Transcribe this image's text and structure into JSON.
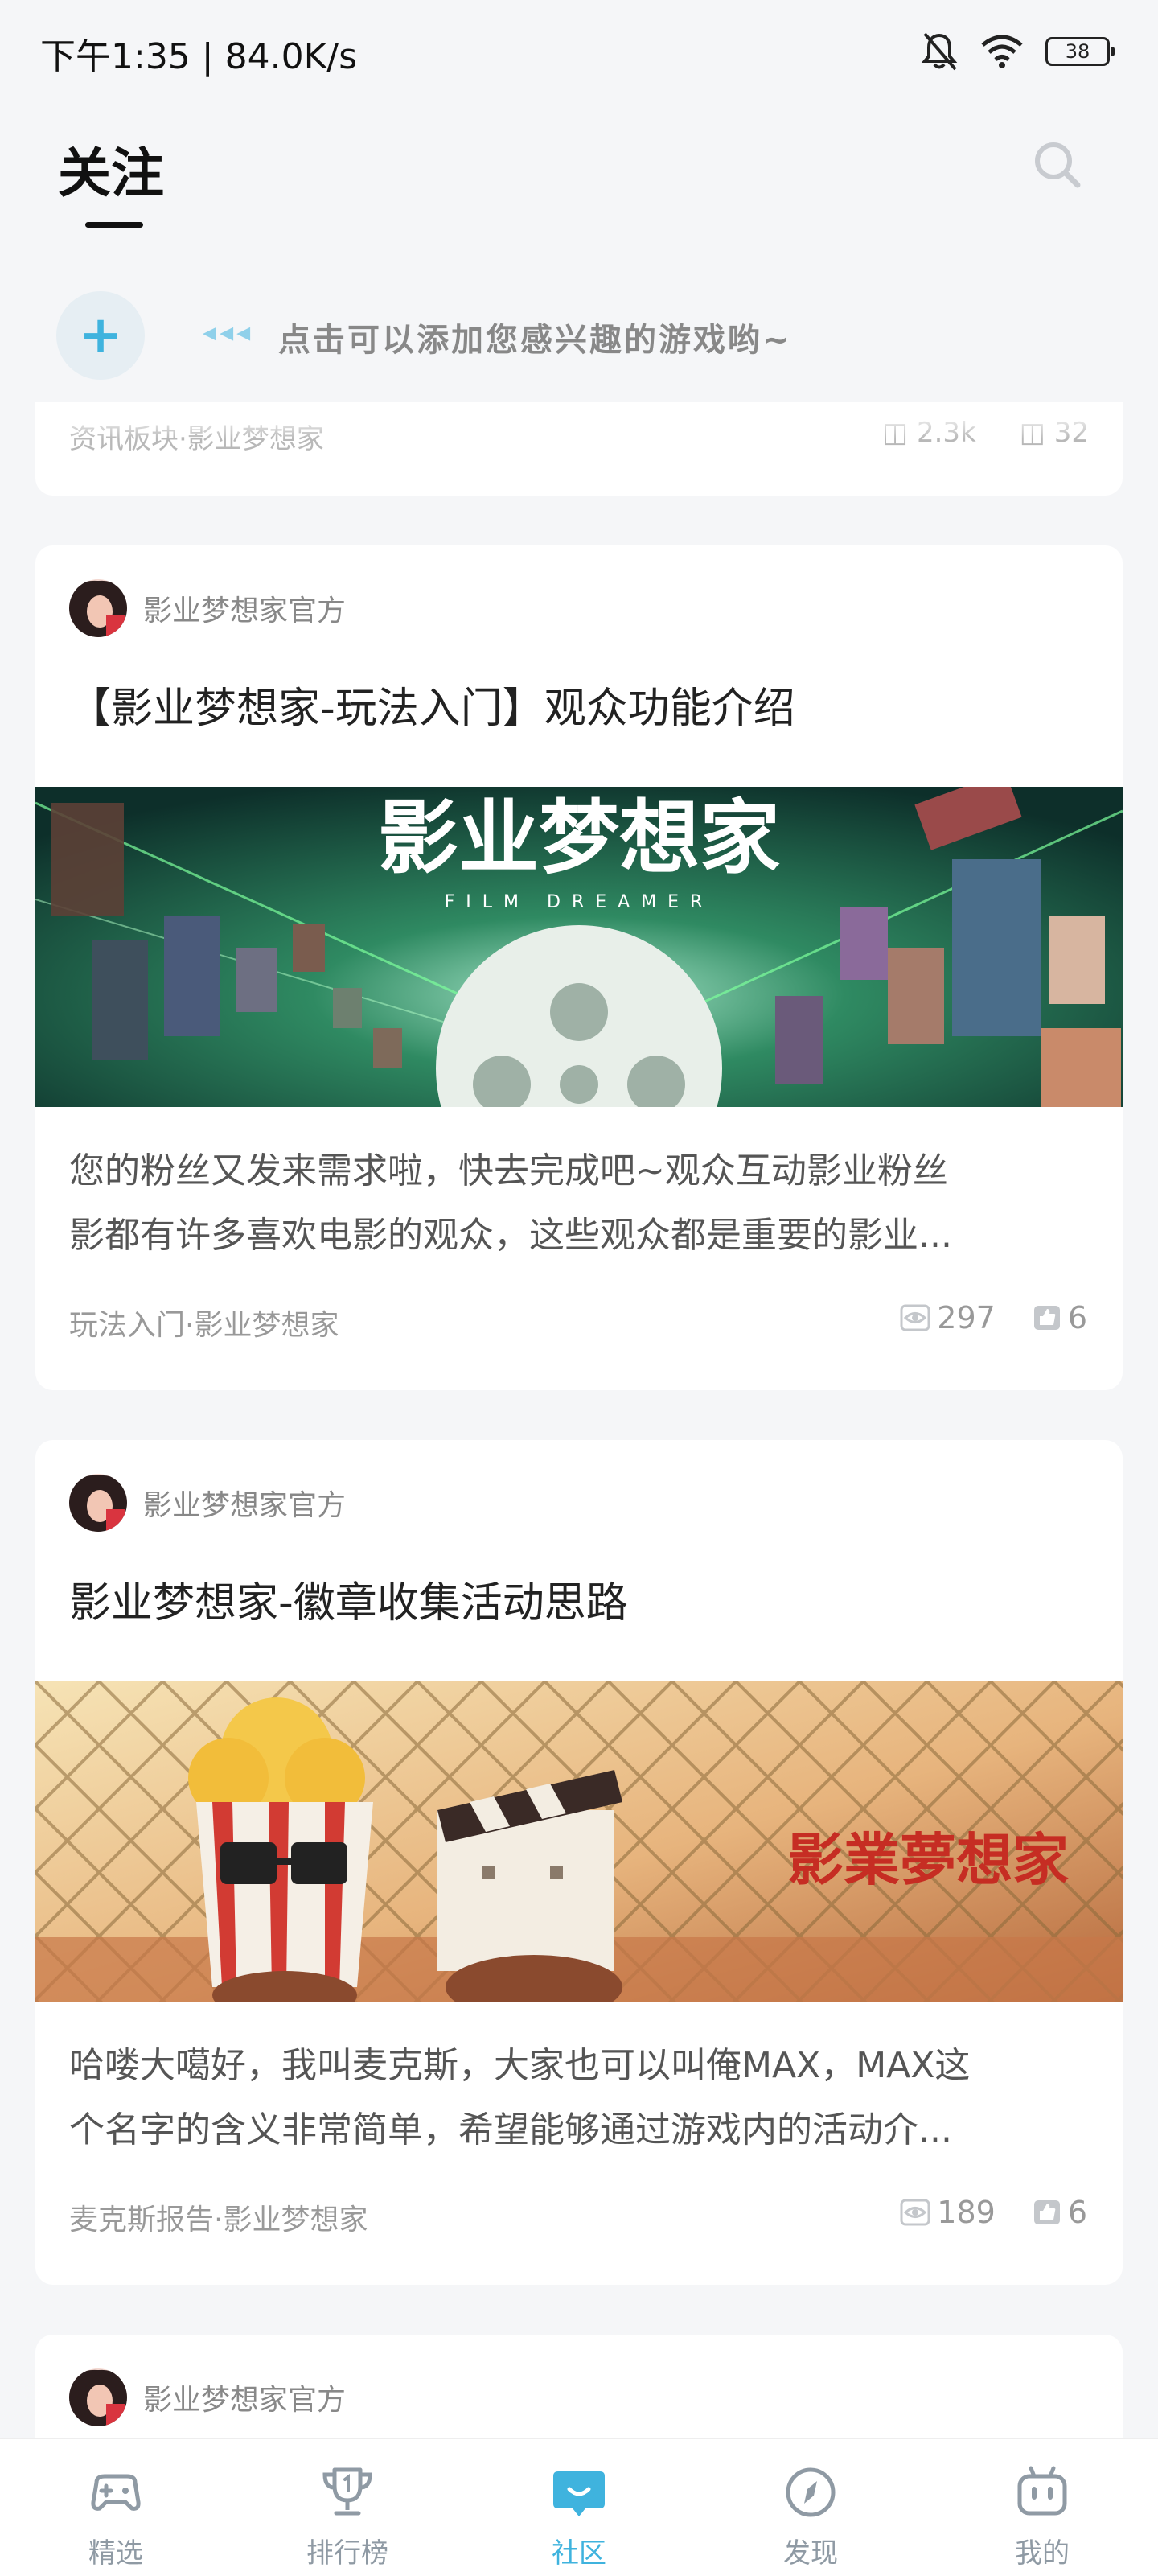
{
  "status_bar": {
    "time_speed": "下午1:35 | 84.0K/s",
    "battery": "38"
  },
  "header": {
    "title": "关注"
  },
  "add_row": {
    "arrows": "◂◂◂",
    "hint": "点击可以添加您感兴趣的游戏哟~"
  },
  "top_card": {
    "meta": "资讯板块·影业梦想家",
    "views": "2.3k",
    "likes": "32"
  },
  "posts": [
    {
      "author": "影业梦想家官方",
      "title": "【影业梦想家-玩法入门】观众功能介绍",
      "banner_title": "影业梦想家",
      "banner_subtitle": "FILM DREAMER",
      "excerpt_line1": "您的粉丝又发来需求啦，快去完成吧~观众互动影业粉丝",
      "excerpt_line2": "影都有许多喜欢电影的观众，这些观众都是重要的影业...",
      "meta": "玩法入门·影业梦想家",
      "views": "297",
      "likes": "6"
    },
    {
      "author": "影业梦想家官方",
      "title": "影业梦想家-徽章收集活动思路",
      "banner_title": "影業夢想家",
      "excerpt_line1": "哈喽大噶好，我叫麦克斯，大家也可以叫俺MAX，MAX这",
      "excerpt_line2": "个名字的含义非常简单，希望能够通过游戏内的活动介...",
      "meta": "麦克斯报告·影业梦想家",
      "views": "189",
      "likes": "6"
    },
    {
      "author": "影业梦想家官方"
    }
  ],
  "tabs": [
    {
      "label": "精选",
      "icon": "gamepad-icon"
    },
    {
      "label": "排行榜",
      "icon": "trophy-icon"
    },
    {
      "label": "社区",
      "icon": "community-chat-icon",
      "active": true
    },
    {
      "label": "发现",
      "icon": "compass-icon"
    },
    {
      "label": "我的",
      "icon": "robot-profile-icon"
    }
  ],
  "colors": {
    "accent": "#3fb3de",
    "background": "#f5f6f8",
    "card": "#ffffff"
  }
}
